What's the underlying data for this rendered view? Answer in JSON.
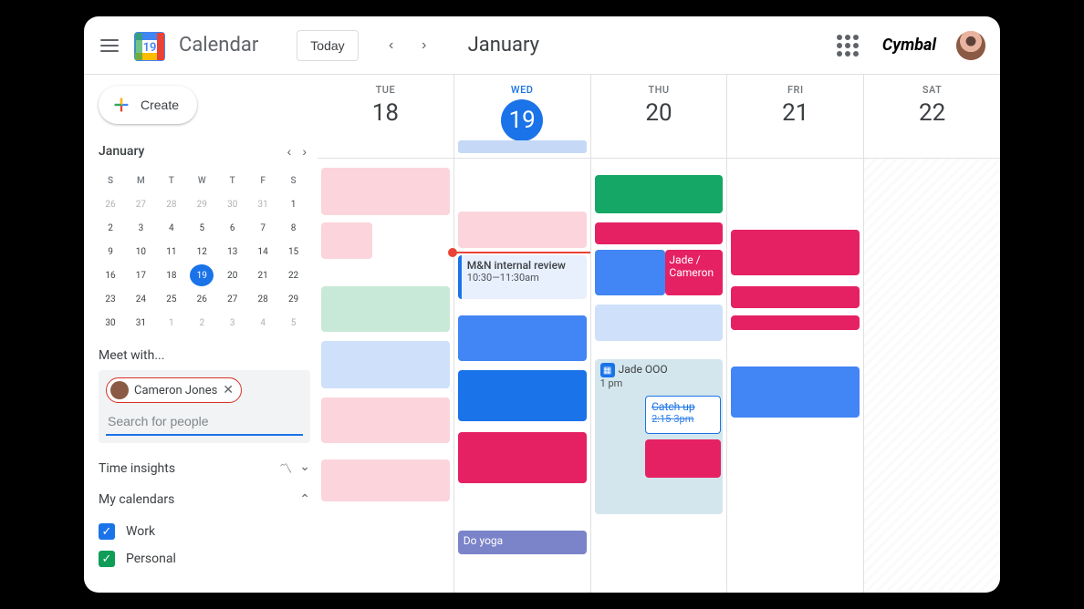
{
  "header": {
    "app_title": "Calendar",
    "today_label": "Today",
    "month_title": "January",
    "brand": "Cymbal",
    "logo_day": "19"
  },
  "sidebar": {
    "create_label": "Create",
    "mini_month": "January",
    "dow": [
      "S",
      "M",
      "T",
      "W",
      "T",
      "F",
      "S"
    ],
    "weeks": [
      [
        {
          "n": "26",
          "m": true
        },
        {
          "n": "27",
          "m": true
        },
        {
          "n": "28",
          "m": true
        },
        {
          "n": "29",
          "m": true
        },
        {
          "n": "30",
          "m": true
        },
        {
          "n": "31",
          "m": true
        },
        {
          "n": "1"
        }
      ],
      [
        {
          "n": "2"
        },
        {
          "n": "3"
        },
        {
          "n": "4"
        },
        {
          "n": "5"
        },
        {
          "n": "6"
        },
        {
          "n": "7"
        },
        {
          "n": "8"
        }
      ],
      [
        {
          "n": "9"
        },
        {
          "n": "10"
        },
        {
          "n": "11"
        },
        {
          "n": "12"
        },
        {
          "n": "13"
        },
        {
          "n": "14"
        },
        {
          "n": "15"
        }
      ],
      [
        {
          "n": "16"
        },
        {
          "n": "17"
        },
        {
          "n": "18"
        },
        {
          "n": "19",
          "today": true
        },
        {
          "n": "20"
        },
        {
          "n": "21"
        },
        {
          "n": "22"
        }
      ],
      [
        {
          "n": "23"
        },
        {
          "n": "24"
        },
        {
          "n": "25"
        },
        {
          "n": "26"
        },
        {
          "n": "27"
        },
        {
          "n": "28"
        },
        {
          "n": "29"
        }
      ],
      [
        {
          "n": "30"
        },
        {
          "n": "31"
        },
        {
          "n": "1",
          "m": true
        },
        {
          "n": "2",
          "m": true
        },
        {
          "n": "3",
          "m": true
        },
        {
          "n": "4",
          "m": true
        },
        {
          "n": "5",
          "m": true
        }
      ]
    ],
    "meet_with_label": "Meet with...",
    "person_chip": "Cameron Jones",
    "search_placeholder": "Search for people",
    "time_insights_label": "Time insights",
    "my_calendars_label": "My calendars",
    "calendars": [
      {
        "name": "Work",
        "color": "blue"
      },
      {
        "name": "Personal",
        "color": "green"
      }
    ]
  },
  "days": [
    {
      "dow": "TUE",
      "num": "18",
      "today": false
    },
    {
      "dow": "WED",
      "num": "19",
      "today": true
    },
    {
      "dow": "THU",
      "num": "20",
      "today": false
    },
    {
      "dow": "FRI",
      "num": "21",
      "today": false
    },
    {
      "dow": "SAT",
      "num": "22",
      "today": false
    }
  ],
  "events": {
    "wed_allday": "",
    "wed_review_title": "M&N internal review",
    "wed_review_time": "10:30—11:30am",
    "wed_yoga": "Do yoga",
    "thu_jade_cameron": "Jade / Cameron",
    "thu_ooo_title": "Jade OOO",
    "thu_ooo_time": "1 pm",
    "thu_catchup_title": "Catch up",
    "thu_catchup_time": "2:15-3pm"
  }
}
